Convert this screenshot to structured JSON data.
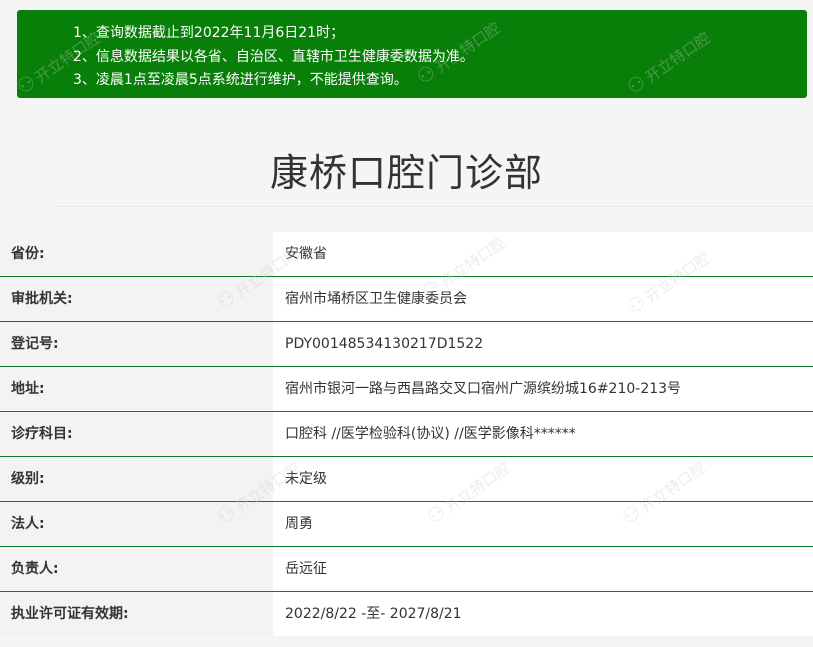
{
  "notice": {
    "lines": [
      "1、查询数据截止到2022年11月6日21时；",
      "2、信息数据结果以各省、自治区、直辖市卫生健康委数据为准。",
      "3、凌晨1点至凌晨5点系统进行维护，不能提供查询。"
    ]
  },
  "title": "康桥口腔门诊部",
  "rows": [
    {
      "label": "省份:",
      "value": "安徽省"
    },
    {
      "label": "审批机关:",
      "value": "宿州市埇桥区卫生健康委员会"
    },
    {
      "label": "登记号:",
      "value": "PDY00148534130217D1522"
    },
    {
      "label": "地址:",
      "value": "宿州市银河一路与西昌路交叉口宿州广源缤纷城16#210-213号"
    },
    {
      "label": "诊疗科目:",
      "value": "口腔科 //医学检验科(协议) //医学影像科******"
    },
    {
      "label": "级别:",
      "value": "未定级"
    },
    {
      "label": "法人:",
      "value": "周勇"
    },
    {
      "label": "负责人:",
      "value": "岳远征"
    },
    {
      "label": "执业许可证有效期:",
      "value": "2022/8/22 -至- 2027/8/21"
    }
  ],
  "watermark": {
    "text": "开立特口腔",
    "icon": "tooth-icon"
  }
}
